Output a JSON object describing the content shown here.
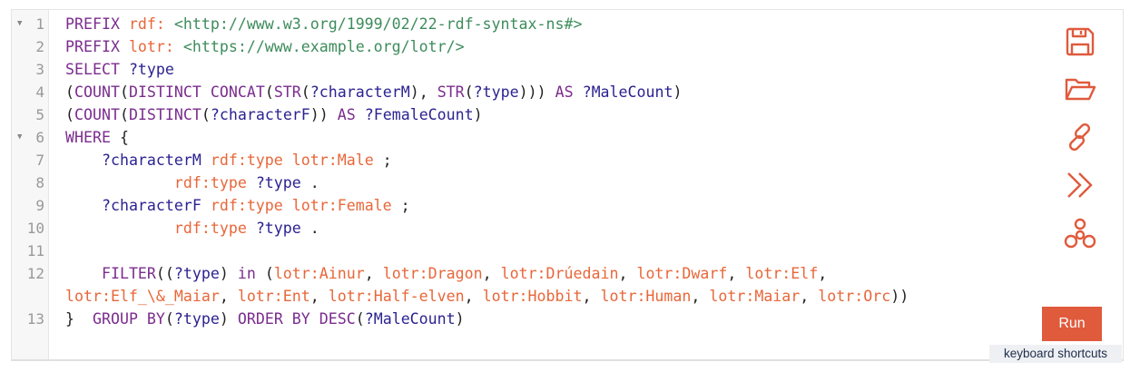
{
  "editor": {
    "lines": [
      {
        "n": "1",
        "fold": true,
        "t": [
          [
            "kw",
            "PREFIX "
          ],
          [
            "pn",
            "rdf: "
          ],
          [
            "uri",
            "<http://www.w3.org/1999/02/22-rdf-syntax-ns#>"
          ]
        ]
      },
      {
        "n": "2",
        "t": [
          [
            "kw",
            "PREFIX "
          ],
          [
            "pn",
            "lotr: "
          ],
          [
            "uri",
            "<https://www.example.org/lotr/>"
          ]
        ]
      },
      {
        "n": "3",
        "t": [
          [
            "kw",
            "SELECT "
          ],
          [
            "var",
            "?type"
          ]
        ]
      },
      {
        "n": "4",
        "t": [
          [
            "p",
            "("
          ],
          [
            "kw",
            "COUNT"
          ],
          [
            "p",
            "("
          ],
          [
            "kw",
            "DISTINCT CONCAT"
          ],
          [
            "p",
            "("
          ],
          [
            "kw",
            "STR"
          ],
          [
            "p",
            "("
          ],
          [
            "var",
            "?characterM"
          ],
          [
            "p",
            "), "
          ],
          [
            "kw",
            "STR"
          ],
          [
            "p",
            "("
          ],
          [
            "var",
            "?type"
          ],
          [
            "p",
            ")))"
          ],
          [
            "kw",
            " AS "
          ],
          [
            "var",
            "?MaleCount"
          ],
          [
            "p",
            ")"
          ]
        ]
      },
      {
        "n": "5",
        "t": [
          [
            "p",
            "("
          ],
          [
            "kw",
            "COUNT"
          ],
          [
            "p",
            "("
          ],
          [
            "kw",
            "DISTINCT"
          ],
          [
            "p",
            "("
          ],
          [
            "var",
            "?characterF"
          ],
          [
            "p",
            "))"
          ],
          [
            "kw",
            " AS "
          ],
          [
            "var",
            "?FemaleCount"
          ],
          [
            "p",
            ")"
          ]
        ]
      },
      {
        "n": "6",
        "fold": true,
        "t": [
          [
            "kw",
            "WHERE "
          ],
          [
            "p",
            "{"
          ]
        ]
      },
      {
        "n": "7",
        "t": [
          [
            "p",
            "    "
          ],
          [
            "var",
            "?characterM "
          ],
          [
            "pn",
            "rdf:type lotr:Male"
          ],
          [
            "p",
            " ;"
          ]
        ]
      },
      {
        "n": "8",
        "t": [
          [
            "p",
            "            "
          ],
          [
            "pn",
            "rdf:type "
          ],
          [
            "var",
            "?type"
          ],
          [
            "p",
            " ."
          ]
        ]
      },
      {
        "n": "9",
        "t": [
          [
            "p",
            "    "
          ],
          [
            "var",
            "?characterF "
          ],
          [
            "pn",
            "rdf:type lotr:Female"
          ],
          [
            "p",
            " ;"
          ]
        ]
      },
      {
        "n": "10",
        "t": [
          [
            "p",
            "            "
          ],
          [
            "pn",
            "rdf:type "
          ],
          [
            "var",
            "?type"
          ],
          [
            "p",
            " ."
          ]
        ]
      },
      {
        "n": "11",
        "t": []
      },
      {
        "n": "12",
        "t": [
          [
            "p",
            "    "
          ],
          [
            "kw",
            "FILTER"
          ],
          [
            "p",
            "(("
          ],
          [
            "var",
            "?type"
          ],
          [
            "p",
            ") "
          ],
          [
            "kw",
            "in"
          ],
          [
            "p",
            " ("
          ],
          [
            "pn",
            "lotr:Ainur"
          ],
          [
            "p",
            ", "
          ],
          [
            "pn",
            "lotr:Dragon"
          ],
          [
            "p",
            ", "
          ],
          [
            "pn",
            "lotr:Drúedain"
          ],
          [
            "p",
            ", "
          ],
          [
            "pn",
            "lotr:Dwarf"
          ],
          [
            "p",
            ", "
          ],
          [
            "pn",
            "lotr:Elf"
          ],
          [
            "p",
            ","
          ],
          [
            "br",
            ""
          ],
          [
            "pn",
            "lotr:Elf_\\&_Maiar"
          ],
          [
            "p",
            ", "
          ],
          [
            "pn",
            "lotr:Ent"
          ],
          [
            "p",
            ", "
          ],
          [
            "pn",
            "lotr:Half-elven"
          ],
          [
            "p",
            ", "
          ],
          [
            "pn",
            "lotr:Hobbit"
          ],
          [
            "p",
            ", "
          ],
          [
            "pn",
            "lotr:Human"
          ],
          [
            "p",
            ", "
          ],
          [
            "pn",
            "lotr:Maiar"
          ],
          [
            "p",
            ", "
          ],
          [
            "pn",
            "lotr:Orc"
          ],
          [
            "p",
            "))"
          ]
        ]
      },
      {
        "n": "13",
        "t": [
          [
            "p",
            "}  "
          ],
          [
            "kw",
            "GROUP BY"
          ],
          [
            "p",
            "("
          ],
          [
            "var",
            "?type"
          ],
          [
            "p",
            ") "
          ],
          [
            "kw",
            "ORDER BY DESC"
          ],
          [
            "p",
            "("
          ],
          [
            "var",
            "?MaleCount"
          ],
          [
            "p",
            ")"
          ]
        ]
      }
    ]
  },
  "toolbar": {
    "icons": [
      "save-icon",
      "open-folder-icon",
      "link-icon",
      "double-chevron-right-icon",
      "network-icon"
    ],
    "accent": "#e05a3c"
  },
  "run_label": "Run",
  "shortcuts_label": "keyboard shortcuts"
}
